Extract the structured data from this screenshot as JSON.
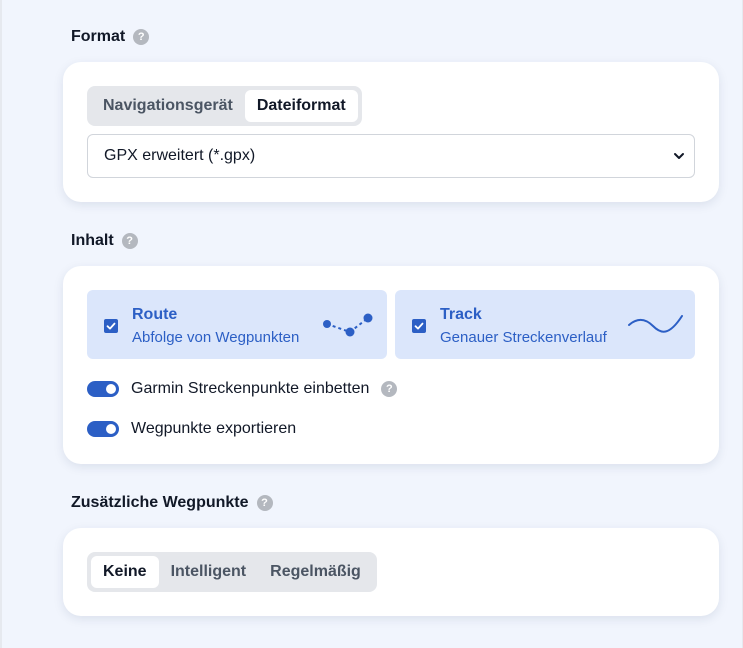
{
  "format": {
    "title": "Format",
    "help_icon": "question-icon",
    "tabs": [
      {
        "label": "Navigationsgerät",
        "active": false
      },
      {
        "label": "Dateiformat",
        "active": true
      }
    ],
    "file_format_selected": "GPX erweitert (*.gpx)"
  },
  "content": {
    "title": "Inhalt",
    "help_icon": "question-icon",
    "route": {
      "title": "Route",
      "subtitle": "Abfolge von Wegpunkten",
      "checked": true,
      "icon": "route-dots-icon"
    },
    "track": {
      "title": "Track",
      "subtitle": "Genauer Streckenverlauf",
      "checked": true,
      "icon": "track-wave-icon"
    },
    "toggles": [
      {
        "label": "Garmin Streckenpunkte einbetten",
        "on": true,
        "has_help": true
      },
      {
        "label": "Wegpunkte exportieren",
        "on": true,
        "has_help": false
      }
    ]
  },
  "extra_waypoints": {
    "title": "Zusätzliche Wegpunkte",
    "help_icon": "question-icon",
    "options": [
      {
        "label": "Keine",
        "active": true
      },
      {
        "label": "Intelligent",
        "active": false
      },
      {
        "label": "Regelmäßig",
        "active": false
      }
    ]
  },
  "colors": {
    "accent": "#2c5fc5",
    "option_card_bg": "#dbe6fb",
    "page_bg": "#f1f5fd"
  }
}
